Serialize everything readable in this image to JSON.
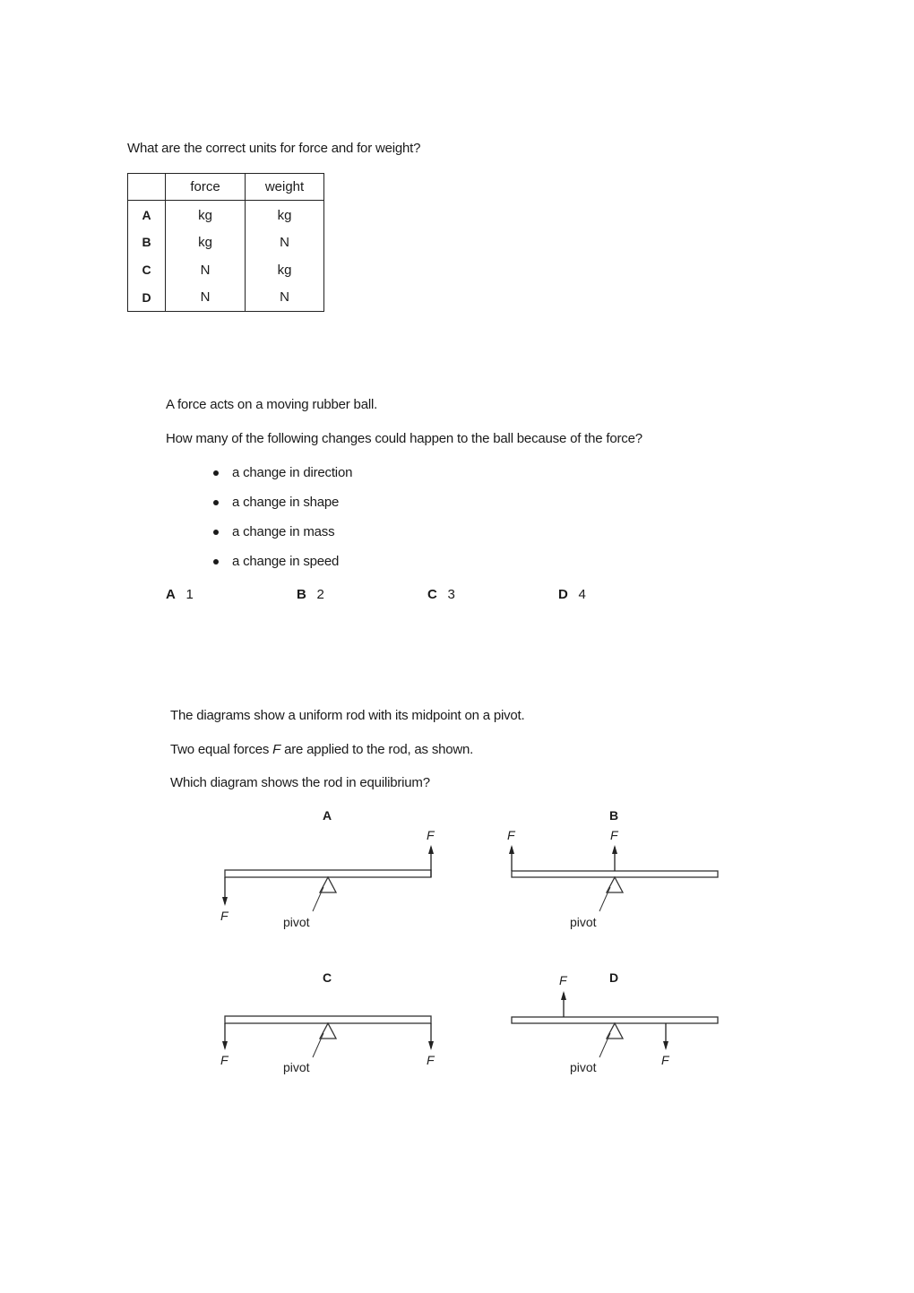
{
  "question1": {
    "prompt": "What are the correct units for force and for weight?",
    "table": {
      "headers": [
        "",
        "force",
        "weight"
      ],
      "rows": [
        {
          "option": "A",
          "force": "kg",
          "weight": "kg"
        },
        {
          "option": "B",
          "force": "kg",
          "weight": "N"
        },
        {
          "option": "C",
          "force": "N",
          "weight": "kg"
        },
        {
          "option": "D",
          "force": "N",
          "weight": "N"
        }
      ]
    }
  },
  "question2": {
    "intro": "A force acts on a moving rubber ball.",
    "prompt": "How many of the following changes could happen to the ball because of the force?",
    "bullets": [
      "a change in direction",
      "a change in shape",
      "a change in mass",
      "a change in speed"
    ],
    "options": [
      {
        "letter": "A",
        "value": "1"
      },
      {
        "letter": "B",
        "value": "2"
      },
      {
        "letter": "C",
        "value": "3"
      },
      {
        "letter": "D",
        "value": "4"
      }
    ]
  },
  "question3": {
    "line1": "The diagrams show a uniform rod with its midpoint on a pivot.",
    "line2_pre": "Two equal forces ",
    "line2_var": "F",
    "line2_post": " are applied to the rod, as shown.",
    "line3": "Which diagram shows the rod in equilibrium?",
    "force_symbol": "F",
    "pivot_label": "pivot",
    "diagrams": [
      {
        "letter": "A",
        "forces": [
          {
            "position": "left-end",
            "direction": "down"
          },
          {
            "position": "right-end",
            "direction": "up"
          }
        ]
      },
      {
        "letter": "B",
        "forces": [
          {
            "position": "left-end",
            "direction": "up"
          },
          {
            "position": "midpoint",
            "direction": "up"
          }
        ]
      },
      {
        "letter": "C",
        "forces": [
          {
            "position": "left-end",
            "direction": "down"
          },
          {
            "position": "right-end",
            "direction": "down"
          }
        ]
      },
      {
        "letter": "D",
        "forces": [
          {
            "position": "quarter-left",
            "direction": "up"
          },
          {
            "position": "quarter-right",
            "direction": "down"
          }
        ]
      }
    ]
  }
}
